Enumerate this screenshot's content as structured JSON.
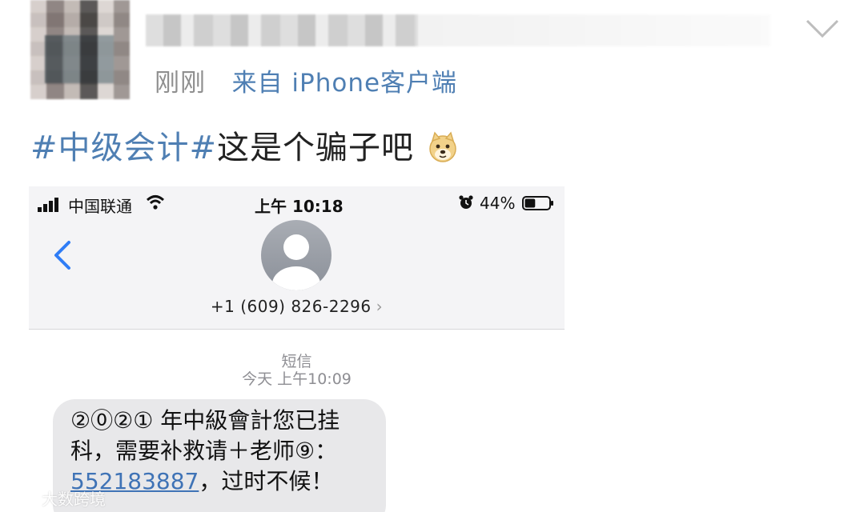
{
  "post": {
    "meta_time": "刚刚",
    "meta_source": "来自 iPhone客户端",
    "topic": "#中级会计#",
    "text": "这是个骗子吧",
    "emoji": "doge-emoji"
  },
  "phone": {
    "status": {
      "carrier": "中国联通",
      "time": "上午 10:18",
      "battery": "44%",
      "battery_level": 0.44
    },
    "contact": {
      "number": "+1 (609) 826-2296",
      "chevron": "›"
    },
    "message": {
      "type": "短信",
      "time": "今天 上午10:09",
      "body_line1": "②⓪②① 年中級會計您已挂",
      "body_line2": "科，需要补救请＋老师⑨：",
      "body_link": "552183887",
      "body_tail": "，过时不候！"
    }
  },
  "watermark": {
    "text": "大数跨境"
  },
  "icons": {
    "collapse": "chevron-down-icon",
    "back": "back-arrow-icon",
    "wifi": "wifi-icon",
    "alarm": "alarm-icon",
    "battery": "battery-icon",
    "signal": "signal-icon"
  }
}
